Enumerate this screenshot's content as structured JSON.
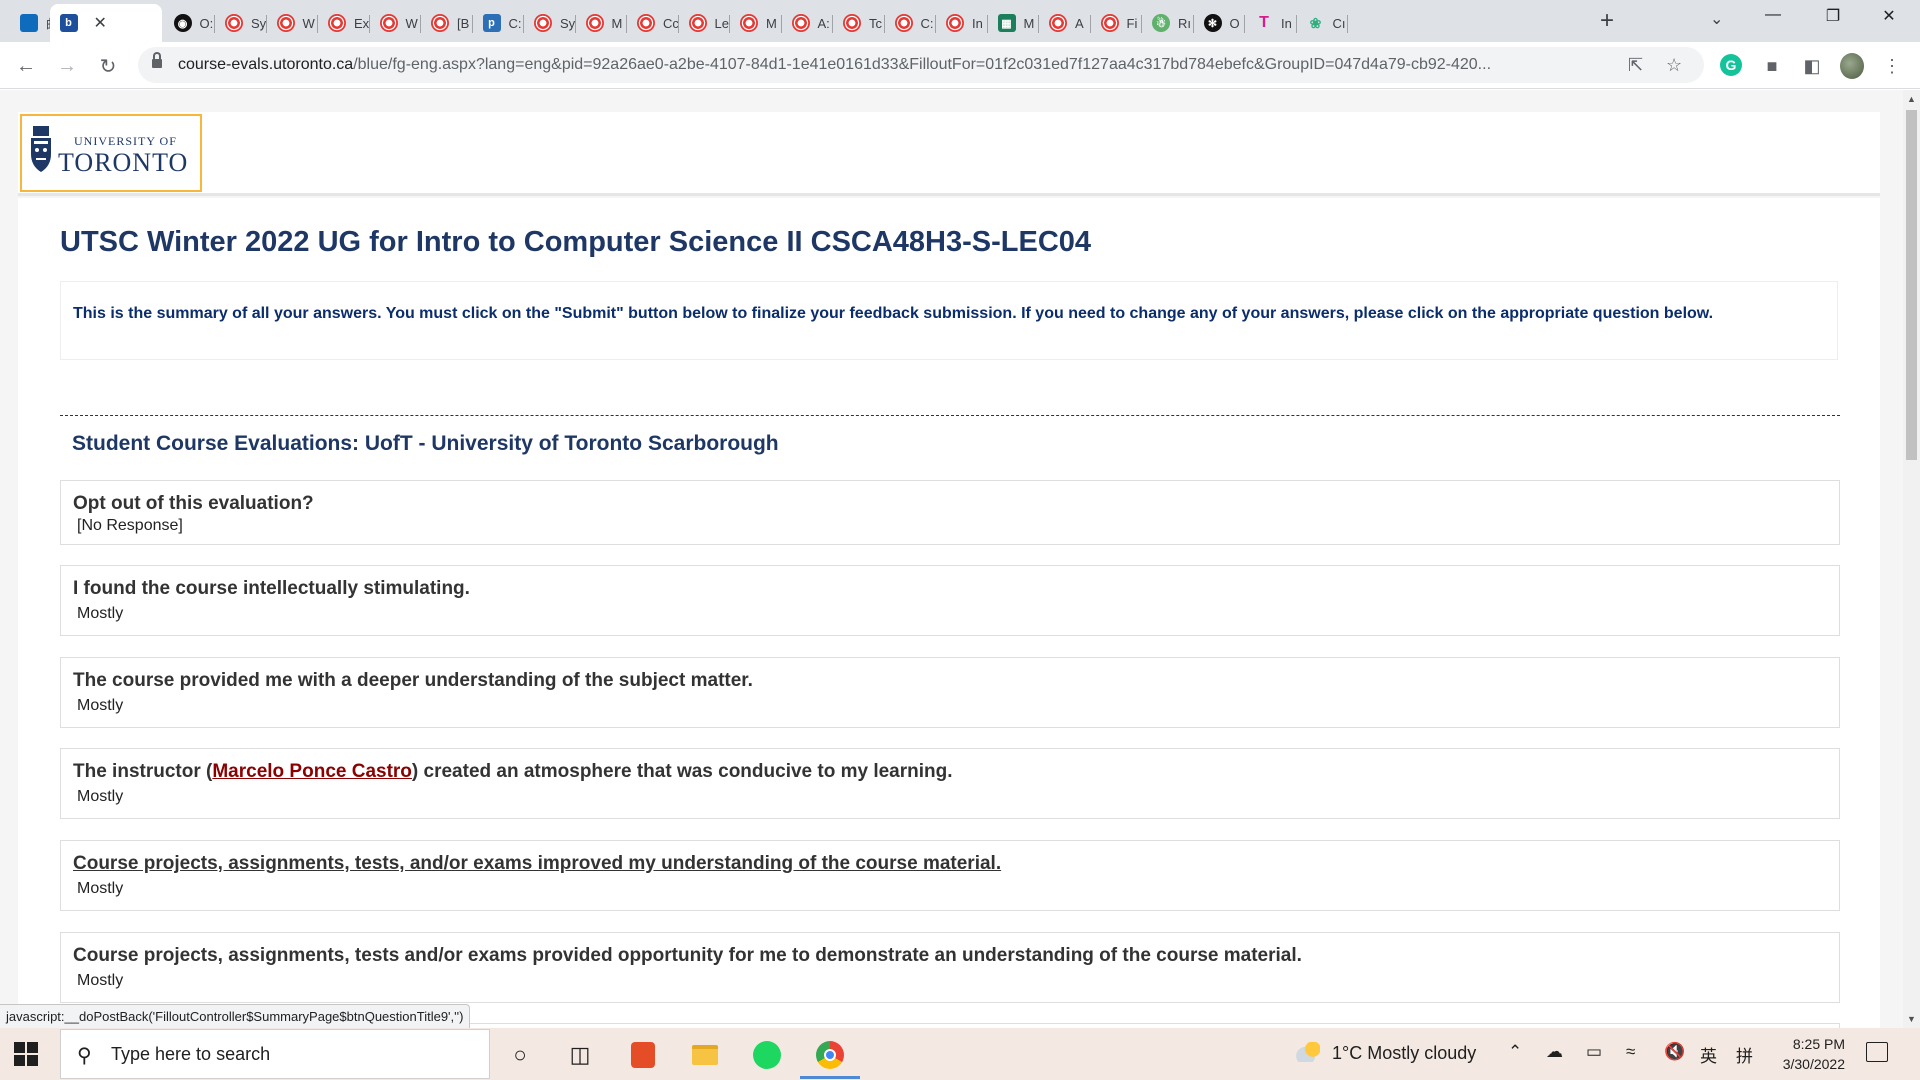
{
  "browser": {
    "tabs": [
      {
        "icon": "outlook-icon",
        "label": "邮"
      },
      {
        "icon": "blue-b-icon",
        "label": "",
        "active": true
      },
      {
        "icon": "dark-circle-icon",
        "label": "O:"
      },
      {
        "icon": "uoft-icon",
        "label": "Sy"
      },
      {
        "icon": "uoft-icon",
        "label": "W"
      },
      {
        "icon": "uoft-icon",
        "label": "Ex"
      },
      {
        "icon": "uoft-icon",
        "label": "W"
      },
      {
        "icon": "uoft-icon",
        "label": "[B"
      },
      {
        "icon": "piazza-icon",
        "label": "C:"
      },
      {
        "icon": "uoft-icon",
        "label": "Sy"
      },
      {
        "icon": "uoft-icon",
        "label": "M"
      },
      {
        "icon": "uoft-icon",
        "label": "Cc"
      },
      {
        "icon": "uoft-icon",
        "label": "Le"
      },
      {
        "icon": "uoft-icon",
        "label": "M"
      },
      {
        "icon": "uoft-icon",
        "label": "A:"
      },
      {
        "icon": "uoft-icon",
        "label": "Tc"
      },
      {
        "icon": "uoft-icon",
        "label": "C:"
      },
      {
        "icon": "uoft-icon",
        "label": "In"
      },
      {
        "icon": "green-icon",
        "label": "M"
      },
      {
        "icon": "uoft-icon",
        "label": "A"
      },
      {
        "icon": "uoft-icon",
        "label": "Fi"
      },
      {
        "icon": "round-green-icon",
        "label": "Rı"
      },
      {
        "icon": "chatgpt-icon",
        "label": "O"
      },
      {
        "icon": "pink-t-icon",
        "label": "In"
      },
      {
        "icon": "leaf-icon",
        "label": "Cı"
      }
    ],
    "new_tab": "+",
    "url_host": "course-evals.utoronto.ca",
    "url_path": "/blue/fg-eng.aspx?lang=eng&pid=92a26ae0-a2be-4107-84d1-1e41e0161d33&FilloutFor=01f2c031ed7f127aa4c317bd784ebefc&GroupID=047d4a79-cb92-420..."
  },
  "logo": {
    "line1": "UNIVERSITY OF",
    "line2": "TORONTO"
  },
  "page": {
    "course_title": "UTSC Winter 2022 UG for Intro to Computer Science II CSCA48H3-S-LEC04",
    "info_text": "This is the summary of all your answers. You must click on the \"Submit\" button below to finalize your feedback submission. If you need to change any of your answers, please click on the appropriate question below.",
    "section_title": "Student Course Evaluations: UofT - University of Toronto Scarborough",
    "questions": [
      {
        "title": "Opt out of this evaluation?",
        "answer": "[No Response]"
      },
      {
        "title": "I found the course intellectually stimulating.",
        "answer": "Mostly"
      },
      {
        "title": "The course provided me with a deeper understanding of the subject matter.",
        "answer": "Mostly"
      },
      {
        "title_pre": "The instructor (",
        "instructor": "Marcelo Ponce Castro",
        "title_post": ") created an atmosphere that was conducive to my learning.",
        "answer": "Mostly"
      },
      {
        "title": "Course projects, assignments, tests, and/or exams improved my understanding of the course material.",
        "answer": "Mostly"
      },
      {
        "title": "Course projects, assignments, tests and/or exams provided opportunity for me to demonstrate an understanding of the course material.",
        "answer": "Mostly"
      }
    ]
  },
  "status_url": "javascript:__doPostBack('FilloutController$SummaryPage$btnQuestionTitle9','')",
  "taskbar": {
    "search_placeholder": "Type here to search",
    "weather": "1°C  Mostly cloudy",
    "tray_lang": "英",
    "tray_ime": "拼",
    "time": "8:25 PM",
    "date": "3/30/2022"
  },
  "colors": {
    "uoft_blue": "#1e3765",
    "link_red": "#8b0000",
    "logo_border": "#f6b73c"
  }
}
